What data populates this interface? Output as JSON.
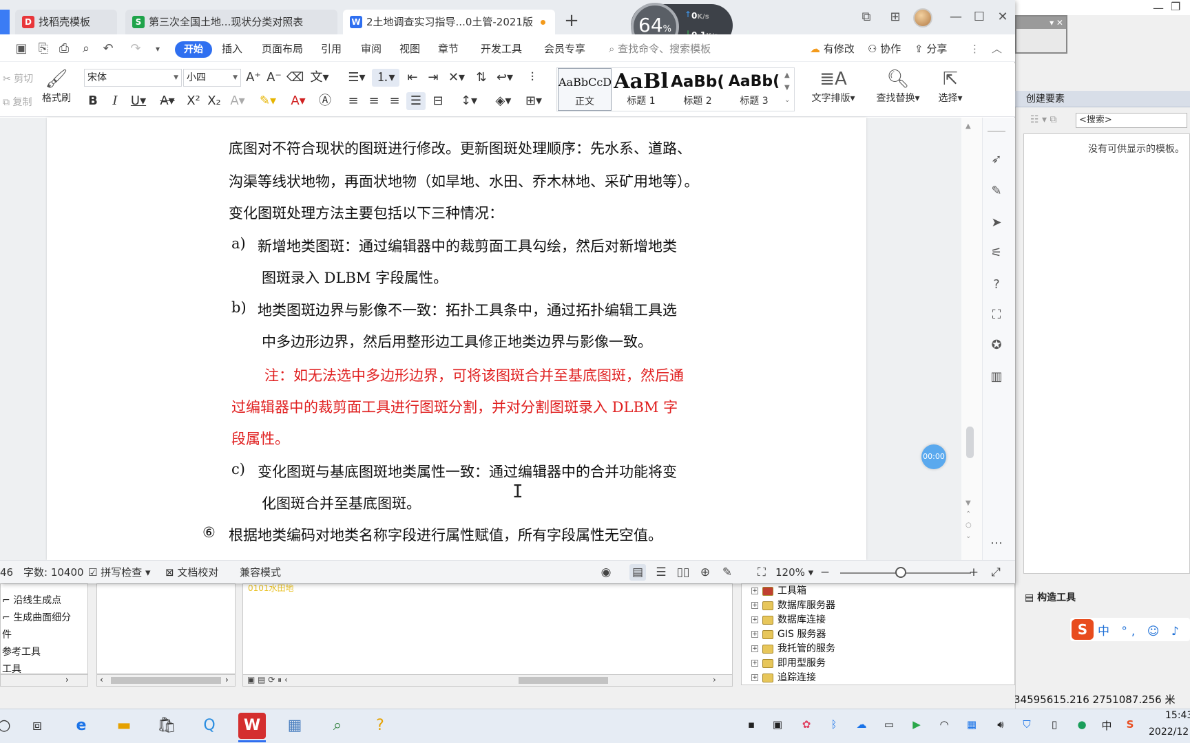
{
  "tabs": [
    {
      "label": "找稻壳模板",
      "icon": "docer-icon",
      "color": "#e8363a"
    },
    {
      "label": "第三次全国土地...现状分类对照表",
      "icon": "spreadsheet-icon",
      "color": "#1fa34a"
    },
    {
      "label": "2土地调查实习指导...0土管-2021版",
      "icon": "writer-icon",
      "color": "#2f6ff0",
      "active": true,
      "unsaved": true
    }
  ],
  "speed": {
    "percent": "64",
    "percent_sign": "%",
    "up": "0",
    "up_unit": "K/s",
    "down": "0.1",
    "down_unit": "K/s"
  },
  "menu": {
    "start": "开始",
    "items": [
      "插入",
      "页面布局",
      "引用",
      "审阅",
      "视图",
      "章节",
      "开发工具",
      "会员专享"
    ],
    "search_placeholder": "查找命令、搜索模板",
    "has_changes": "有修改",
    "collab": "协作",
    "share": "分享"
  },
  "ribbon": {
    "cut": "剪切",
    "copy": "复制",
    "format_painter": "格式刷",
    "font_name": "宋体",
    "font_size": "小四",
    "styles": [
      {
        "preview": "AaBbCcDd",
        "label": "正文"
      },
      {
        "preview": "AaBl",
        "label": "标题 1"
      },
      {
        "preview": "AaBb(",
        "label": "标题 2"
      },
      {
        "preview": "AaBb(",
        "label": "标题 3"
      }
    ],
    "text_layout": "文字排版",
    "find_replace": "查找替换",
    "select": "选择"
  },
  "document": {
    "lines": [
      "底图对不符合现状的图斑进行修改。更新图斑处理顺序：先水系、道路、",
      "沟渠等线状地物，再面状地物（如旱地、水田、乔木林地、采矿用地等）。",
      "变化图斑处理方法主要包括以下三种情况："
    ],
    "item_a_marker": "a)",
    "item_a_1": "新增地类图斑：通过编辑器中的裁剪面工具勾绘，然后对新增地类",
    "item_a_2": "图斑录入 DLBM 字段属性。",
    "item_b_marker": "b)",
    "item_b_1": "地类图斑边界与影像不一致：拓扑工具条中，通过拓扑编辑工具选",
    "item_b_2": "中多边形边界，然后用整形边工具修正地类边界与影像一致。",
    "note_1": "注：如无法选中多边形边界，可将该图斑合并至基底图斑，然后通",
    "note_2": "过编辑器中的裁剪面工具进行图斑分割，并对分割图斑录入 DLBM 字",
    "note_3": "段属性。",
    "item_c_marker": "c)",
    "item_c_1": "变化图斑与基底图斑地类属性一致：通过编辑器中的合并功能将变",
    "item_c_2": "化图斑合并至基底图斑。",
    "item_6_marker": "⑥",
    "item_6": "根据地类编码对地类名称字段进行属性赋值，所有字段属性无空值。",
    "note_color": "#e02020"
  },
  "timer": "00:00",
  "status": {
    "page_partial": "46",
    "word_count": "字数: 10400",
    "spell_check": "拼写检查",
    "doc_proof": "文档校对",
    "compat_mode": "兼容模式",
    "zoom": "120%"
  },
  "arcgis": {
    "create_features": "创建要素",
    "search_placeholder": "<搜索>",
    "no_templates": "没有可供显示的模板。",
    "left_list": [
      "沿线生成点",
      "生成曲面细分",
      "件",
      "参考工具",
      "工具"
    ],
    "yellow_text": "0101水田地",
    "catalog": [
      "工具箱",
      "数据库服务器",
      "数据库连接",
      "GIS 服务器",
      "我托管的服务",
      "即用型服务",
      "追踪连接"
    ],
    "build_tools": "构造工具",
    "coords": "34595615.216  2751087.256 米"
  },
  "ime": {
    "text": "中 °, ☺ ♪ ⌨"
  },
  "taskbar": {
    "apps": [
      "task-view-icon",
      "edge-icon",
      "file-explorer-icon",
      "store-icon",
      "qq-browser-icon",
      "wps-icon",
      "arcmap-icon",
      "search-app-icon",
      "help-app-icon"
    ],
    "ime_lang": "中",
    "time": "15:43",
    "date": "2022/12"
  }
}
